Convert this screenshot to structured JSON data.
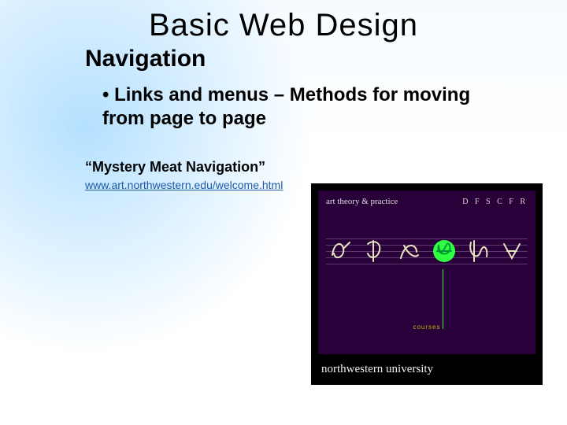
{
  "title": "Basic Web Design",
  "heading": "Navigation",
  "bullet": "Links and menus – Methods for moving from page to page",
  "subhead": "“Mystery Meat Navigation”",
  "link_text": "www.art.northwestern.edu/welcome.html",
  "screenshot": {
    "brand_left": "art theory & practice",
    "brand_right": "D F S C F R",
    "center_label": "courses",
    "footer": "northwestern university"
  }
}
